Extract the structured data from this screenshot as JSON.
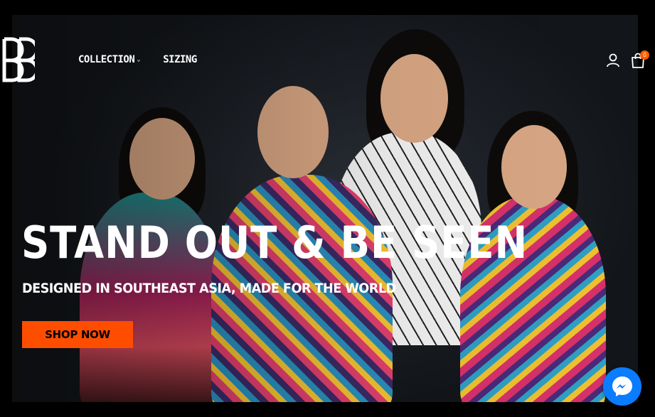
{
  "brand": {
    "logo_text": "BB"
  },
  "nav": {
    "items": [
      {
        "label": "COLLECTION",
        "has_dropdown": true
      },
      {
        "label": "SIZING",
        "has_dropdown": false
      }
    ]
  },
  "header_icons": {
    "account": "user-icon",
    "cart": "shopping-bag-icon",
    "cart_count": "0"
  },
  "hero": {
    "headline": "STAND OUT & BE SEEN",
    "subheadline": "DESIGNED IN SOUTHEAST ASIA, MADE FOR THE WORLD",
    "cta_label": "SHOP NOW",
    "image_alt": "Four cyclists in colorful jerseys standing with arms crossed"
  },
  "chat": {
    "icon": "messenger-icon"
  },
  "colors": {
    "accent": "#ff4d00",
    "badge": "#ff5a00",
    "messenger": "#0a7cff",
    "background": "#000000"
  }
}
